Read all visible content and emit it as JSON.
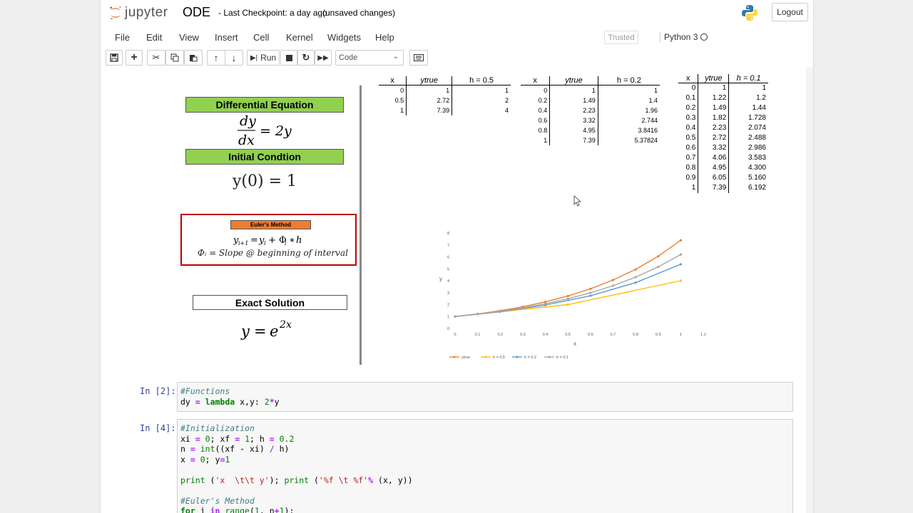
{
  "header": {
    "logo_text": "jupyter",
    "notebook_name": "ODE",
    "checkpoint": "- Last Checkpoint: a day ago",
    "unsaved": "(unsaved changes)",
    "logout": "Logout"
  },
  "menu": [
    "File",
    "Edit",
    "View",
    "Insert",
    "Cell",
    "Kernel",
    "Widgets",
    "Help"
  ],
  "status": {
    "trusted": "Trusted",
    "kernel": "Python 3"
  },
  "toolbar": {
    "run_label": "Run",
    "cell_type": "Code"
  },
  "markdown": {
    "de_header": "Differential Equation",
    "ic_header": "Initial Condtion",
    "euler_header": "Euler's Method",
    "exact_header": "Exact Solution",
    "eq_ic": "y(0) = 1",
    "euler_line2": "Φᵢ = Slope @ beginning of interval"
  },
  "tables": {
    "h05": {
      "header": [
        "x",
        "ytrue",
        "h = 0.5"
      ],
      "rows": [
        [
          "0",
          "1",
          "1"
        ],
        [
          "0.5",
          "2.72",
          "2"
        ],
        [
          "1",
          "7.39",
          "4"
        ]
      ]
    },
    "h02": {
      "header": [
        "x",
        "ytrue",
        "h = 0.2"
      ],
      "rows": [
        [
          "0",
          "1",
          "1"
        ],
        [
          "0.2",
          "1.49",
          "1.4"
        ],
        [
          "0.4",
          "2.23",
          "1.96"
        ],
        [
          "0.6",
          "3.32",
          "2.744"
        ],
        [
          "0.8",
          "4.95",
          "3.8416"
        ],
        [
          "1",
          "7.39",
          "5.37824"
        ]
      ]
    },
    "h01": {
      "header": [
        "x",
        "ytrue",
        "h = 0.1"
      ],
      "rows": [
        [
          "0",
          "1",
          "1"
        ],
        [
          "0.1",
          "1.22",
          "1.2"
        ],
        [
          "0.2",
          "1.49",
          "1.44"
        ],
        [
          "0.3",
          "1.82",
          "1.728"
        ],
        [
          "0.4",
          "2.23",
          "2.074"
        ],
        [
          "0.5",
          "2.72",
          "2.488"
        ],
        [
          "0.6",
          "3.32",
          "2.986"
        ],
        [
          "0.7",
          "4.06",
          "3.583"
        ],
        [
          "0.8",
          "4.95",
          "4.300"
        ],
        [
          "0.9",
          "6.05",
          "5.160"
        ],
        [
          "1",
          "7.39",
          "6.192"
        ]
      ]
    }
  },
  "chart_data": {
    "type": "line",
    "xlabel": "x",
    "ylabel": "y",
    "xlim": [
      0,
      1.1
    ],
    "ylim": [
      0,
      8
    ],
    "xticks": [
      "0",
      "0.1",
      "0.2",
      "0.3",
      "0.4",
      "0.5",
      "0.6",
      "0.7",
      "0.8",
      "0.9",
      "1",
      "1.1"
    ],
    "yticks": [
      "0",
      "1",
      "2",
      "3",
      "4",
      "5",
      "6",
      "7",
      "8"
    ],
    "legend_position": "bottom",
    "series": [
      {
        "name": "ytrue",
        "color": "#ed7d31",
        "x": [
          0,
          0.1,
          0.2,
          0.3,
          0.4,
          0.5,
          0.6,
          0.7,
          0.8,
          0.9,
          1
        ],
        "y": [
          1,
          1.22,
          1.49,
          1.82,
          2.23,
          2.72,
          3.32,
          4.06,
          4.95,
          6.05,
          7.39
        ]
      },
      {
        "name": "h = 0.5",
        "color": "#ffc000",
        "x": [
          0,
          0.5,
          1
        ],
        "y": [
          1,
          2,
          4
        ]
      },
      {
        "name": "h = 0.2",
        "color": "#5b9bd5",
        "x": [
          0,
          0.2,
          0.4,
          0.6,
          0.8,
          1
        ],
        "y": [
          1,
          1.4,
          1.96,
          2.744,
          3.8416,
          5.37824
        ]
      },
      {
        "name": "h = 0.1",
        "color": "#a5a5a5",
        "x": [
          0,
          0.1,
          0.2,
          0.3,
          0.4,
          0.5,
          0.6,
          0.7,
          0.8,
          0.9,
          1
        ],
        "y": [
          1,
          1.2,
          1.44,
          1.728,
          2.074,
          2.488,
          2.986,
          3.583,
          4.3,
          5.16,
          6.192
        ]
      }
    ]
  },
  "cells": [
    {
      "prompt": "In [2]:"
    },
    {
      "prompt": "In [4]:"
    }
  ]
}
